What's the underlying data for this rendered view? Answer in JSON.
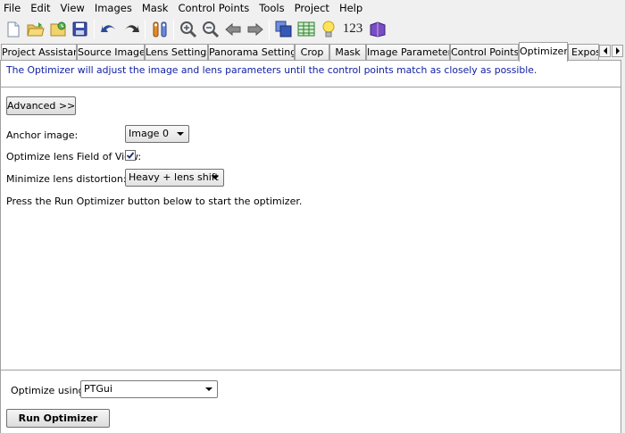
{
  "menu": [
    "File",
    "Edit",
    "View",
    "Images",
    "Mask",
    "Control Points",
    "Tools",
    "Project",
    "Help"
  ],
  "toolbar": {
    "icons": [
      "new-file-icon",
      "open-folder-icon",
      "open-recent-icon",
      "save-icon",
      "undo-icon",
      "redo-icon",
      "preferences-icon",
      "zoom-in-icon",
      "zoom-out-icon",
      "previous-icon",
      "next-icon",
      "fast-preview-icon",
      "table-icon",
      "lightbulb-icon",
      "identify-icon",
      "help-book-icon"
    ],
    "number_button": "123"
  },
  "tabs": [
    {
      "label": "Project Assistant",
      "active": false
    },
    {
      "label": "Source Images",
      "active": false
    },
    {
      "label": "Lens Settings",
      "active": false
    },
    {
      "label": "Panorama Settings",
      "active": false
    },
    {
      "label": "Crop",
      "active": false
    },
    {
      "label": "Mask",
      "active": false
    },
    {
      "label": "Image Parameters",
      "active": false
    },
    {
      "label": "Control Points",
      "active": false
    },
    {
      "label": "Optimizer",
      "active": true
    },
    {
      "label": "Exposu",
      "active": false
    }
  ],
  "optimizer": {
    "info_text": "The Optimizer will adjust the image and lens parameters until the control points match as closely as possible.",
    "advanced_button": "Advanced >>",
    "anchor_label": "Anchor image:",
    "anchor_value": "Image 0",
    "fov_label": "Optimize lens Field of View:",
    "fov_checked": true,
    "distortion_label": "Minimize lens distortion:",
    "distortion_value": "Heavy + lens shift",
    "hint_text": "Press the Run Optimizer button below to start the optimizer.",
    "optimize_using_label": "Optimize using:",
    "optimize_using_value": "PTGui",
    "run_button": "Run Optimizer"
  },
  "colors": {
    "info_text": "#0e1ca3",
    "background": "#f0f0f0",
    "page": "#ffffff"
  }
}
